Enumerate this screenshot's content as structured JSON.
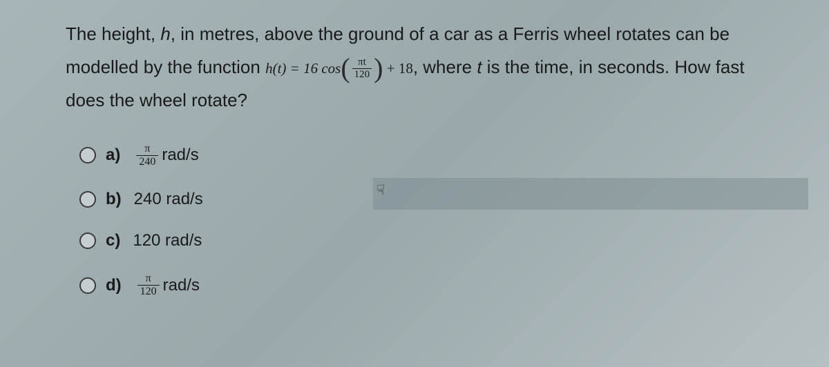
{
  "question": {
    "part1": "The height, ",
    "var_h": "h",
    "part2": ", in metres, above the ground of a car as a Ferris wheel rotates can be modelled by the function ",
    "func_lhs": "h(t) = 16 cos",
    "frac_num": "πt",
    "frac_den": "120",
    "func_rhs": " + 18",
    "part3": ", where ",
    "var_t": "t",
    "part4": " is the time, in seconds. How fast does the wheel rotate?"
  },
  "options": {
    "a": {
      "label": "a)",
      "frac_num": "π",
      "frac_den": "240",
      "unit": "rad/s"
    },
    "b": {
      "label": "b)",
      "text": "240 rad/s"
    },
    "c": {
      "label": "c)",
      "text": "120 rad/s"
    },
    "d": {
      "label": "d)",
      "frac_num": "π",
      "frac_den": "120",
      "unit": "rad/s"
    }
  },
  "cursor_glyph": "☟"
}
